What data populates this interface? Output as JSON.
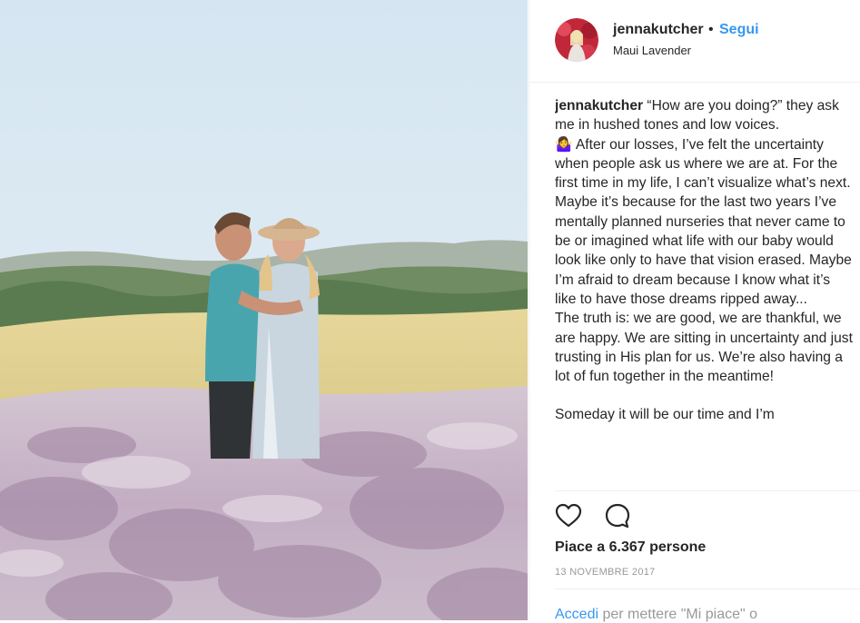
{
  "post": {
    "username": "jennakutcher",
    "separator": "•",
    "follow_label": "Segui",
    "location": "Maui Lavender",
    "caption_user": "jennakutcher",
    "caption_lines": [
      " “How are you doing?” they ask me in hushed tones and low voices.",
      "🤷‍♀️ After our losses, I’ve felt the uncertainty when people ask us where we are at. For the first time in my life, I can’t visualize what’s next.",
      "Maybe it’s because for the last two years I’ve mentally planned nurseries that never came to be or imagined what life with our baby would look like only to have that vision erased. Maybe I’m afraid to dream because I know what it’s like to have those dreams ripped away...",
      "The truth is: we are good, we are thankful, we are happy. We are sitting in uncertainty and just trusting in His plan for us. We’re also having a lot of fun together in the meantime!",
      "",
      "Someday it will be our time and I’m"
    ],
    "likes": "Piace a 6.367 persone",
    "date": "13 NOVEMBRE 2017",
    "login_link": "Accedi",
    "login_text": " per mettere \"Mi piace\" o"
  },
  "icons": {
    "like": "heart-icon",
    "comment": "comment-icon"
  }
}
